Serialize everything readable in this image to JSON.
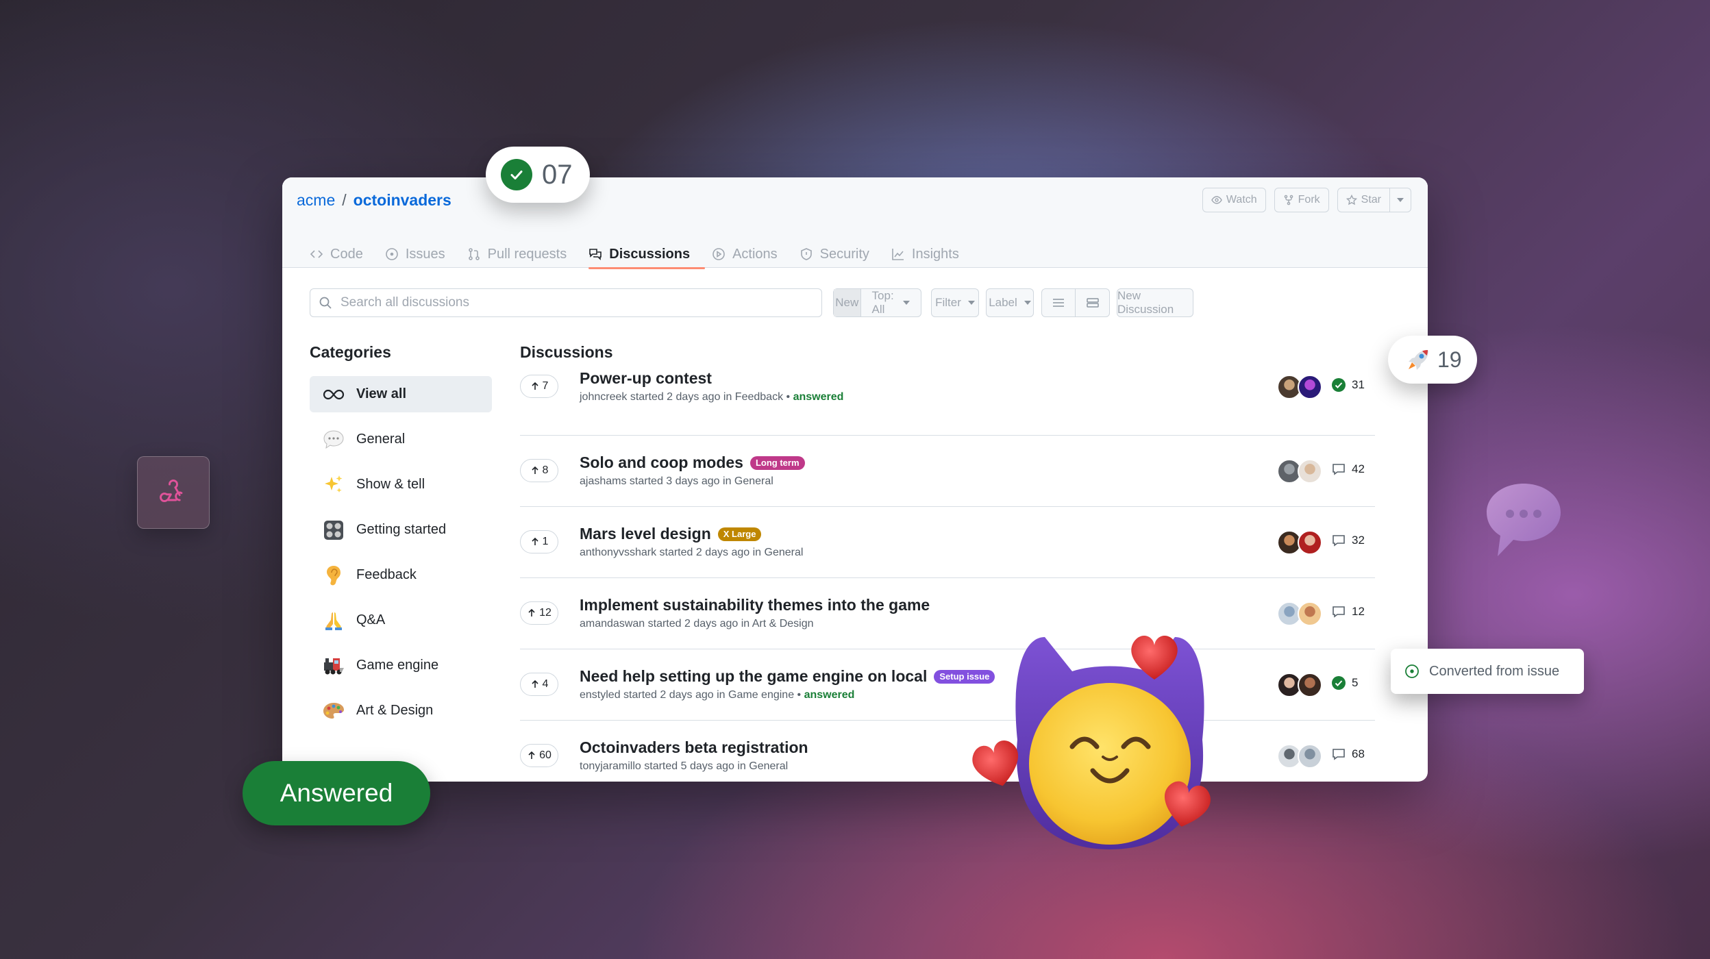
{
  "repo": {
    "owner": "acme",
    "separator": "/",
    "name": "octoinvaders"
  },
  "repo_actions": {
    "watch": "Watch",
    "fork": "Fork",
    "star": "Star"
  },
  "tabs": [
    {
      "label": "Code",
      "icon": "code-icon"
    },
    {
      "label": "Issues",
      "icon": "issue-icon"
    },
    {
      "label": "Pull requests",
      "icon": "pull-request-icon"
    },
    {
      "label": "Discussions",
      "icon": "discussion-icon",
      "active": true
    },
    {
      "label": "Actions",
      "icon": "play-icon"
    },
    {
      "label": "Security",
      "icon": "shield-icon"
    },
    {
      "label": "Insights",
      "icon": "graph-icon"
    }
  ],
  "toolbar": {
    "search_placeholder": "Search all discussions",
    "sort_new": "New",
    "sort_top": "Top: All",
    "filter": "Filter",
    "label": "Label",
    "new_discussion": "New Discussion"
  },
  "categories": {
    "title": "Categories",
    "items": [
      {
        "label": "View all",
        "icon": "infinity-icon",
        "active": true
      },
      {
        "label": "General",
        "icon": "speech-bubble-emoji"
      },
      {
        "label": "Show & tell",
        "icon": "sparkles-emoji"
      },
      {
        "label": "Getting started",
        "icon": "control-knobs-emoji"
      },
      {
        "label": "Feedback",
        "icon": "ear-emoji"
      },
      {
        "label": "Q&A",
        "icon": "folded-hands-emoji"
      },
      {
        "label": "Game engine",
        "icon": "locomotive-emoji"
      },
      {
        "label": "Art & Design",
        "icon": "artist-palette-emoji"
      }
    ]
  },
  "discussions": {
    "title": "Discussions",
    "items": [
      {
        "votes": "7",
        "title": "Power-up contest",
        "meta": "johncreek started 2 days ago in Feedback",
        "answered": "answered",
        "count": "31",
        "stat_icon": "check-circle-icon",
        "label": null
      },
      {
        "votes": "8",
        "title": "Solo and coop modes",
        "meta": "ajashams started 3 days ago in General",
        "answered": null,
        "count": "42",
        "stat_icon": "comment-icon",
        "label": "Long term",
        "label_color": "#bf3989"
      },
      {
        "votes": "1",
        "title": "Mars level design",
        "meta": "anthonyvsshark started 2 days ago in General",
        "answered": null,
        "count": "32",
        "stat_icon": "comment-icon",
        "label": "X Large",
        "label_color": "#bf8700"
      },
      {
        "votes": "12",
        "title": "Implement sustainability themes into the game",
        "meta": "amandaswan started 2 days ago in Art & Design",
        "answered": null,
        "count": "12",
        "stat_icon": "comment-icon",
        "label": null
      },
      {
        "votes": "4",
        "title": "Need help setting up the game engine on local",
        "meta": "enstyled started 2 days ago in Game engine",
        "answered": "answered",
        "count": "5",
        "stat_icon": "check-circle-icon",
        "label": "Setup issue",
        "label_color": "#8250df"
      },
      {
        "votes": "60",
        "title": "Octoinvaders beta registration",
        "meta": "tonyjaramillo started 5 days ago in General",
        "answered": null,
        "count": "68",
        "stat_icon": "comment-icon",
        "label": null
      }
    ]
  },
  "badges": {
    "answered_count": "07",
    "rocket_count": "19",
    "answered_pill": "Answered",
    "converted": "Converted from issue"
  },
  "colors": {
    "accent": "#0969da",
    "success": "#1a7f37",
    "tab_underline": "#fd8c73"
  }
}
